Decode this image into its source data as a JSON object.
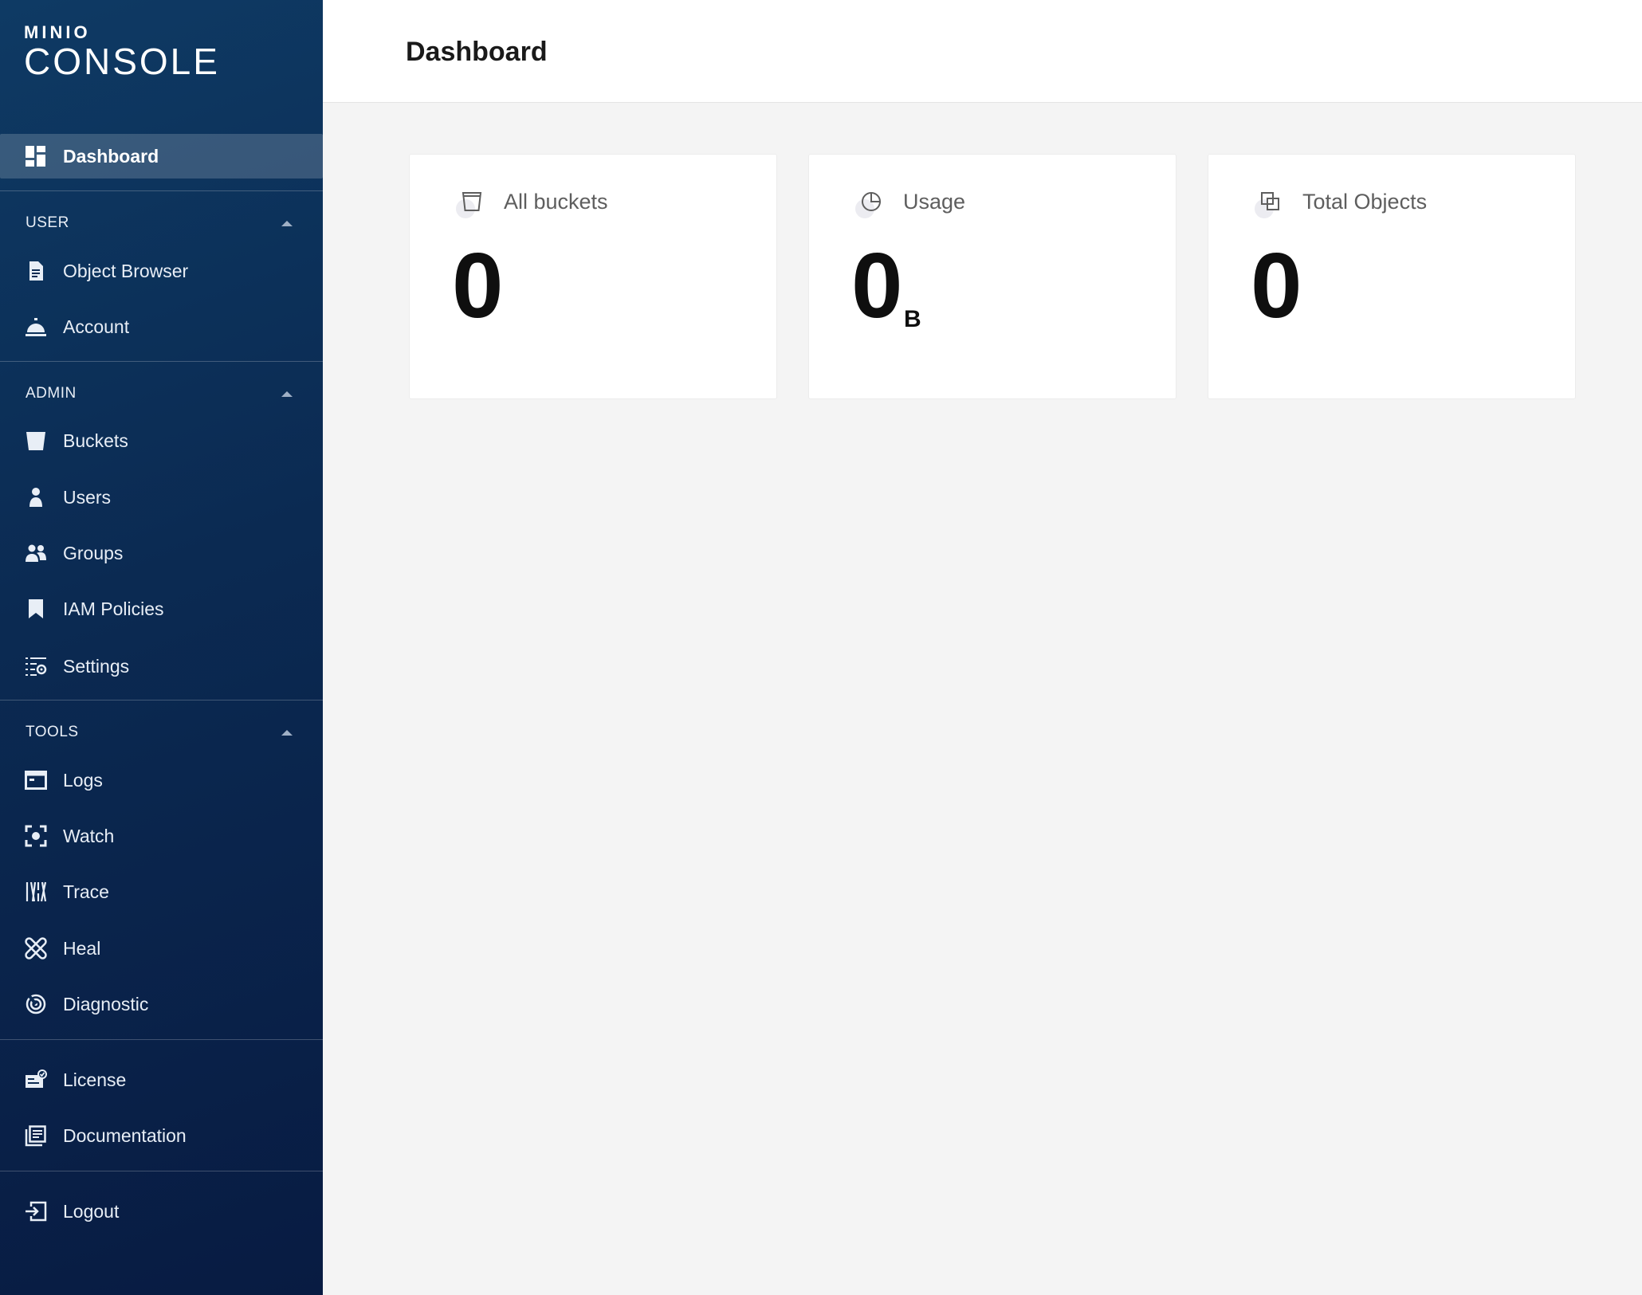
{
  "app": {
    "logo_top": "MINIO",
    "logo_bottom": "CONSOLE"
  },
  "sidebar": {
    "dashboard": "Dashboard",
    "sections": {
      "user": "USER",
      "admin": "ADMIN",
      "tools": "TOOLS"
    },
    "items": {
      "object_browser": "Object Browser",
      "account": "Account",
      "buckets": "Buckets",
      "users": "Users",
      "groups": "Groups",
      "iam_policies": "IAM Policies",
      "settings": "Settings",
      "logs": "Logs",
      "watch": "Watch",
      "trace": "Trace",
      "heal": "Heal",
      "diagnostic": "Diagnostic",
      "license": "License",
      "documentation": "Documentation",
      "logout": "Logout"
    },
    "active": "dashboard"
  },
  "header": {
    "title": "Dashboard"
  },
  "cards": [
    {
      "label": "All buckets",
      "value": "0",
      "unit": "",
      "icon": "bucket-icon"
    },
    {
      "label": "Usage",
      "value": "0",
      "unit": "B",
      "icon": "pie-chart-icon"
    },
    {
      "label": "Total Objects",
      "value": "0",
      "unit": "",
      "icon": "objects-icon"
    }
  ],
  "colors": {
    "sidebar_top": "#0e3a64",
    "sidebar_bottom": "#081b42",
    "content_bg": "#f4f4f4",
    "card_bg": "#ffffff"
  }
}
